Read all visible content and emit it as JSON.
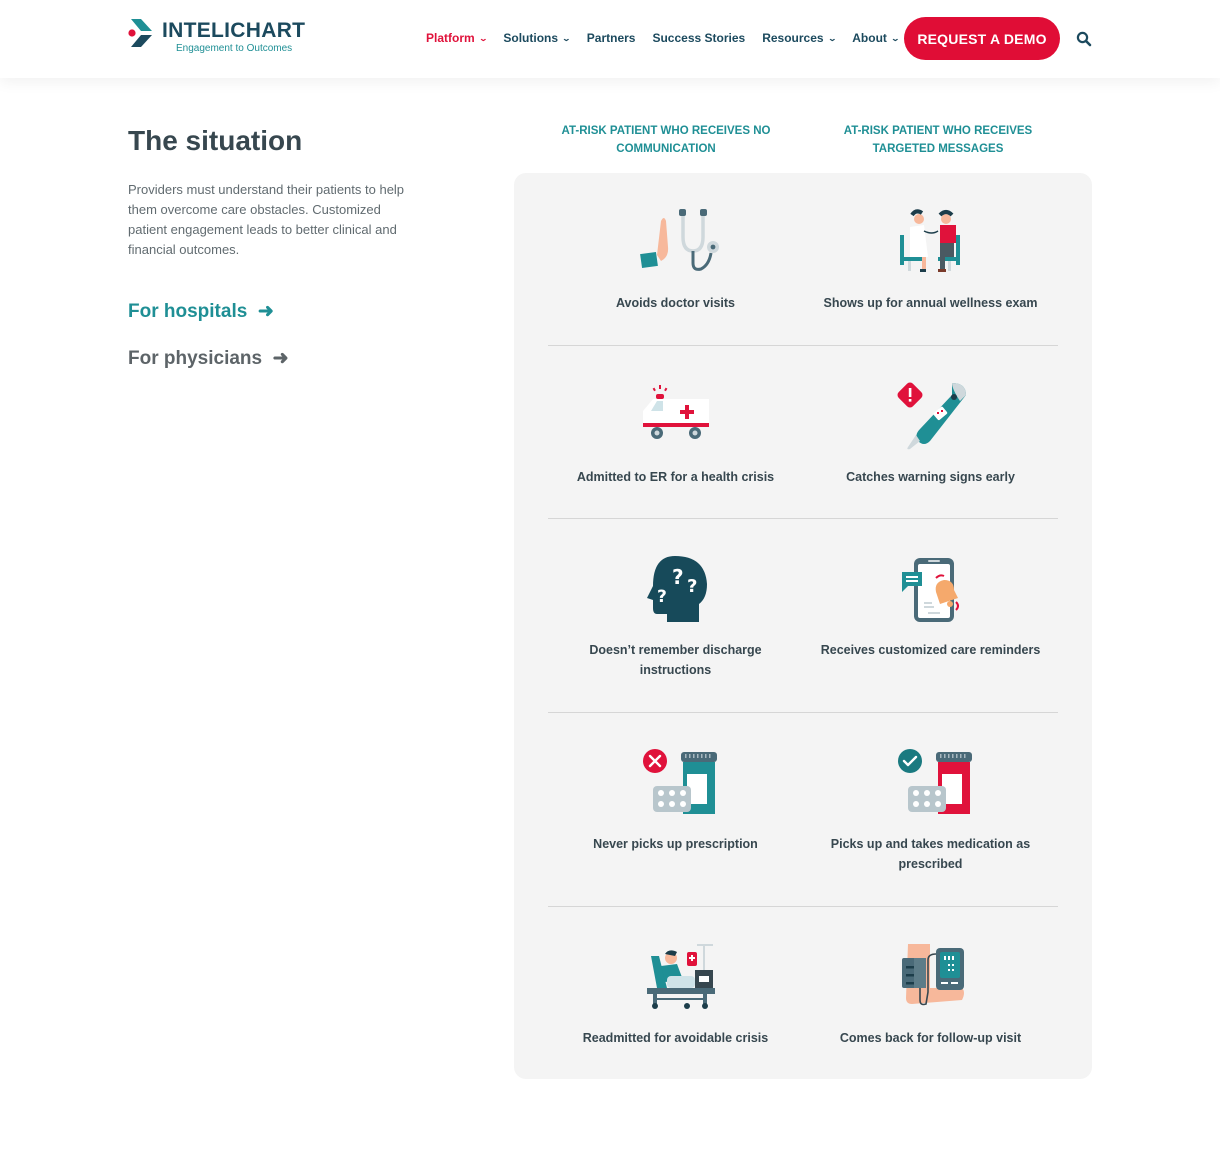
{
  "header": {
    "logo": {
      "name": "INTELICHART",
      "tagline": "Engagement to Outcomes"
    },
    "nav": [
      {
        "label": "Platform",
        "dropdown": true,
        "active": true
      },
      {
        "label": "Solutions",
        "dropdown": true,
        "active": false
      },
      {
        "label": "Partners",
        "dropdown": false,
        "active": false
      },
      {
        "label": "Success Stories",
        "dropdown": false,
        "active": false
      },
      {
        "label": "Resources",
        "dropdown": true,
        "active": false
      },
      {
        "label": "About",
        "dropdown": true,
        "active": false
      }
    ],
    "cta_label": "REQUEST A DEMO",
    "search_icon": "search-icon"
  },
  "intro": {
    "title": "The situation",
    "description": "Providers must understand their patients to help them overcome care obstacles. Customized patient engagement leads to better clinical and financial outcomes.",
    "links": [
      {
        "label": "For hospitals",
        "icon": "arrow-right-icon"
      },
      {
        "label": "For physicians",
        "icon": "arrow-right-icon"
      }
    ]
  },
  "comparison": {
    "columns": [
      "AT-RISK PATIENT WHO RECEIVES NO COMMUNICATION",
      "AT-RISK PATIENT WHO RECEIVES TARGETED MESSAGES"
    ],
    "rows": [
      {
        "left": {
          "icon": "declined-stethoscope-icon",
          "caption": "Avoids doctor visits"
        },
        "right": {
          "icon": "wellness-exam-icon",
          "caption": "Shows up for annual wellness exam"
        }
      },
      {
        "left": {
          "icon": "ambulance-icon",
          "caption": "Admitted to ER for a health crisis"
        },
        "right": {
          "icon": "thermometer-warning-icon",
          "caption": "Catches warning signs early"
        }
      },
      {
        "left": {
          "icon": "confused-head-icon",
          "caption": "Doesn’t remember discharge instructions"
        },
        "right": {
          "icon": "phone-reminder-icon",
          "caption": "Receives customized care reminders"
        }
      },
      {
        "left": {
          "icon": "prescription-missed-icon",
          "caption": "Never picks up prescription"
        },
        "right": {
          "icon": "prescription-taken-icon",
          "caption": "Picks up and takes medication as prescribed"
        }
      },
      {
        "left": {
          "icon": "hospital-bed-icon",
          "caption": "Readmitted for avoidable crisis"
        },
        "right": {
          "icon": "blood-pressure-monitor-icon",
          "caption": "Comes back for follow-up visit"
        }
      }
    ]
  },
  "colors": {
    "brand_navy": "#1c4a5e",
    "brand_teal": "#1f8f95",
    "accent_red": "#e00d36",
    "panel_bg": "#f4f4f4"
  }
}
